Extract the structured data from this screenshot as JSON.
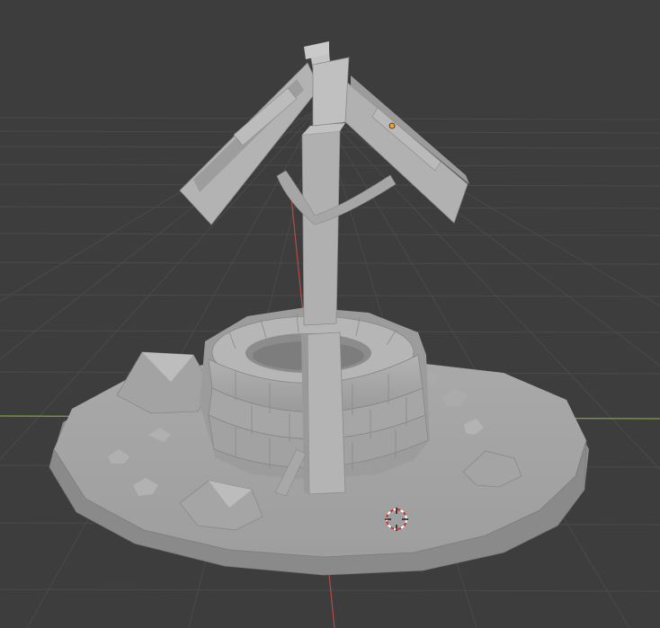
{
  "app": "3D viewport",
  "viewport": {
    "background": "#3d3d3d",
    "grid_color": "#4a4a4a",
    "x_axis_color": "#7fa33a",
    "y_axis_color": "#b84a4a",
    "mesh_color": "#a8a8a8",
    "origin_color": "#f0a030",
    "cursor_colors": [
      "#cc3333",
      "#ffffff"
    ]
  },
  "scene": {
    "object": "well-model",
    "parts": [
      "ground-disc",
      "stone-well",
      "wooden-post",
      "roof",
      "rocks"
    ]
  }
}
